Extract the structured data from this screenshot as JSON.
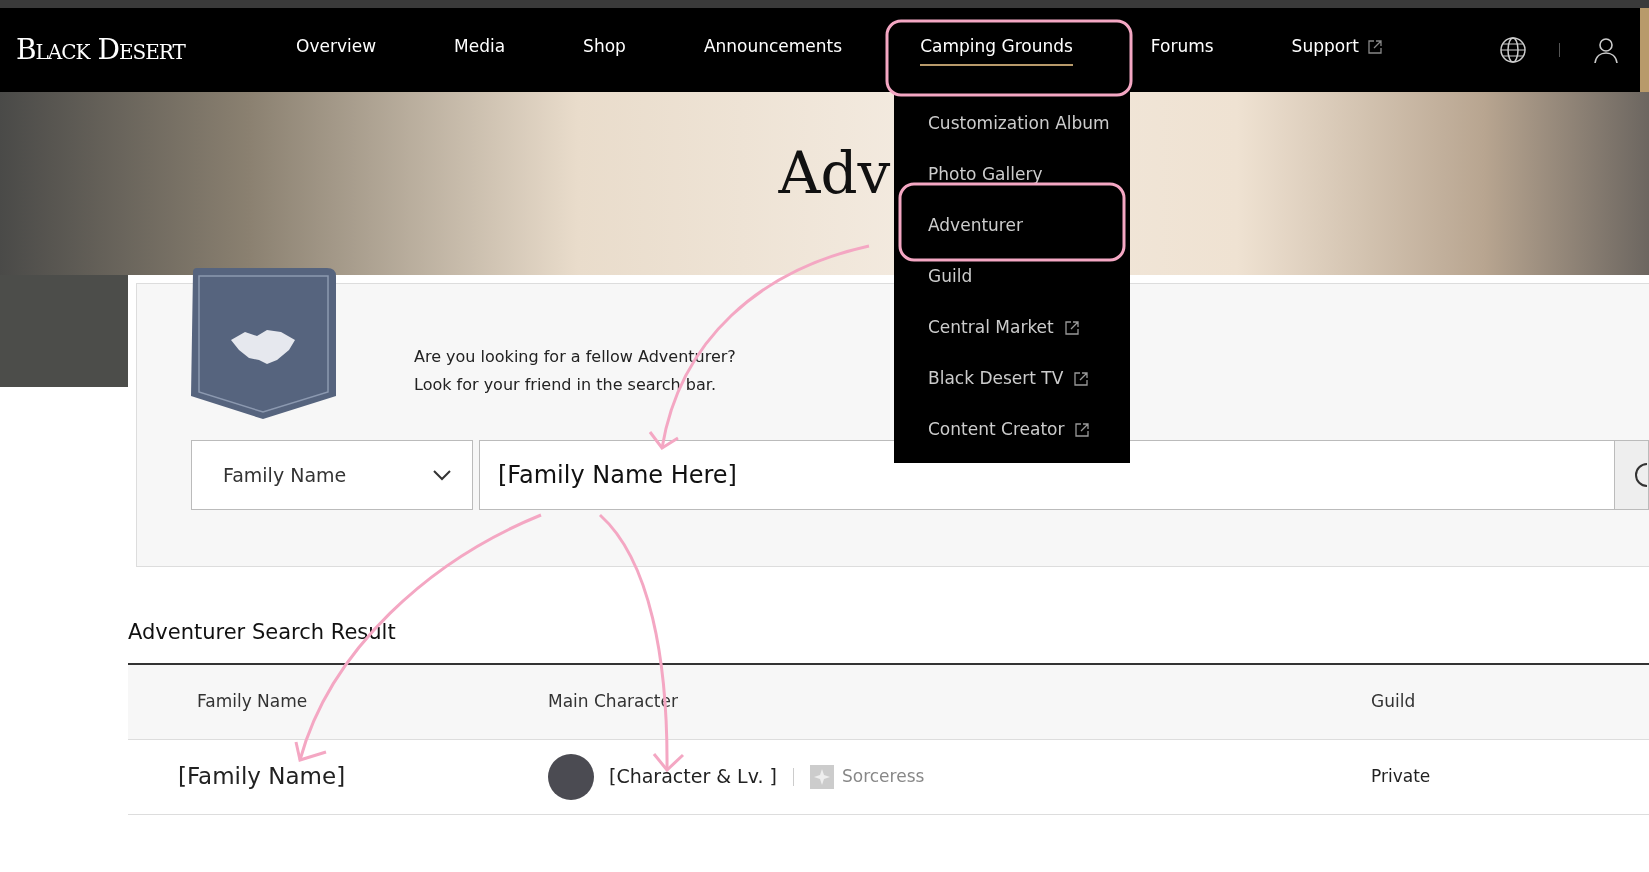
{
  "header": {
    "logo": "Black Desert",
    "nav": [
      {
        "label": "Overview",
        "selected": false,
        "external": false
      },
      {
        "label": "Media",
        "selected": false,
        "external": false
      },
      {
        "label": "Shop",
        "selected": false,
        "external": false
      },
      {
        "label": "Announcements",
        "selected": false,
        "external": false
      },
      {
        "label": "Camping Grounds",
        "selected": true,
        "external": false
      },
      {
        "label": "Forums",
        "selected": false,
        "external": false
      },
      {
        "label": "Support",
        "selected": false,
        "external": true
      }
    ]
  },
  "dropdown": {
    "items": [
      {
        "label": "Customization Album",
        "external": false
      },
      {
        "label": "Photo Gallery",
        "external": false
      },
      {
        "label": "Adventurer",
        "external": false
      },
      {
        "label": "Guild",
        "external": false
      },
      {
        "label": "Central Market",
        "external": true
      },
      {
        "label": "Black Desert TV",
        "external": true
      },
      {
        "label": "Content Creator",
        "external": true
      }
    ]
  },
  "hero": {
    "title": "Adv"
  },
  "search_panel": {
    "intro": [
      "Are you looking for a fellow Adventurer?",
      "Look for your friend in the search bar."
    ],
    "search_type": "Family Name",
    "search_value": "[Family Name Here]"
  },
  "results": {
    "title": "Adventurer Search Result",
    "columns": [
      "Family Name",
      "Main Character",
      "Guild"
    ],
    "rows": [
      {
        "family_name": "[Family Name]",
        "character": "[Character & Lv. ]",
        "class": "Sorceress",
        "guild": "Private"
      }
    ]
  }
}
